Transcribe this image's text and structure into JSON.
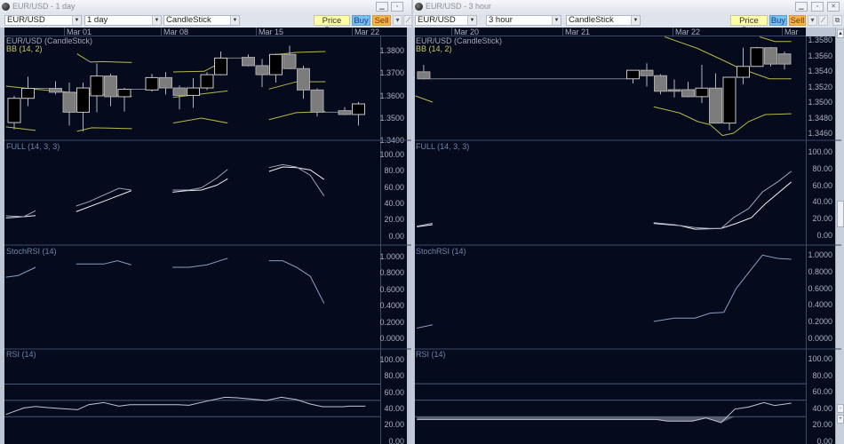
{
  "windows": [
    {
      "title": "EUR/USD - 1 day",
      "symbol": "EUR/USD",
      "interval": "1 day",
      "chart_type": "CandleStick",
      "buttons": {
        "price_box": "Price Box",
        "buy": "Buy",
        "sell": "Sell"
      },
      "time_labels": [
        "Mar 01",
        "Mar 08",
        "Mar 15",
        "Mar 22"
      ],
      "price_label": "EUR/USD (CandleStick)",
      "bb_label": "BB (14, 2)",
      "full_label": "FULL (14, 3, 3)",
      "stoch_label": "StochRSI (14)",
      "rsi_label": "RSI (14)",
      "price_ticks": [
        "1.3800",
        "1.3700",
        "1.3600",
        "1.3500",
        "1.3400"
      ],
      "full_ticks": [
        "100.00",
        "80.00",
        "60.00",
        "40.00",
        "20.00",
        "0.00"
      ],
      "stoch_ticks": [
        "1.0000",
        "0.8000",
        "0.6000",
        "0.4000",
        "0.2000",
        "0.0000"
      ],
      "rsi_ticks": [
        "100.00",
        "80.00",
        "60.00",
        "40.00",
        "20.00",
        "0.00"
      ],
      "rsi_levels": [
        70,
        50,
        30
      ],
      "candles": [
        [
          0,
          1.348,
          1.3599,
          1.345,
          1.3588
        ],
        [
          1,
          1.3588,
          1.3684,
          1.3553,
          1.3632
        ],
        [
          3,
          1.3632,
          1.3664,
          1.3605,
          1.3615
        ],
        [
          4,
          1.3615,
          1.3658,
          1.3467,
          1.3526
        ],
        [
          5,
          1.3526,
          1.3658,
          1.3441,
          1.3634
        ],
        [
          6,
          1.3599,
          1.3743,
          1.3526,
          1.3687
        ],
        [
          7,
          1.3687,
          1.3697,
          1.3553,
          1.3595
        ],
        [
          8,
          1.3595,
          1.3634,
          1.3529,
          1.3628
        ],
        [
          10,
          1.3625,
          1.3697,
          1.3618,
          1.368
        ],
        [
          11,
          1.368,
          1.3704,
          1.3605,
          1.3634
        ],
        [
          12,
          1.3634,
          1.3645,
          1.3539,
          1.3601
        ],
        [
          13,
          1.3601,
          1.3678,
          1.3546,
          1.3634
        ],
        [
          14,
          1.3634,
          1.3704,
          1.3625,
          1.3693
        ],
        [
          15,
          1.3693,
          1.3796,
          1.3691,
          1.3767
        ],
        [
          17,
          1.377,
          1.3783,
          1.373,
          1.3733
        ],
        [
          18,
          1.3733,
          1.3763,
          1.3638,
          1.3693
        ],
        [
          19,
          1.3693,
          1.3787,
          1.3658,
          1.3783
        ],
        [
          20,
          1.3783,
          1.3822,
          1.3717,
          1.372
        ],
        [
          21,
          1.372,
          1.3733,
          1.3586,
          1.3625
        ],
        [
          22,
          1.3625,
          1.3632,
          1.3507,
          1.3526
        ],
        [
          24,
          1.3533,
          1.3549,
          1.3513,
          1.3516
        ],
        [
          25,
          1.3516,
          1.3572,
          1.3467,
          1.3563
        ]
      ],
      "bb": {
        "upper": [
          [
            [
              4.56,
              1.3786
            ],
            [
              5.53,
              1.3749
            ],
            [
              6.39,
              1.3751
            ],
            [
              8.54,
              1.3747
            ]
          ],
          [
            [
              11.55,
              1.3705
            ],
            [
              13.8,
              1.3708
            ],
            [
              15.5,
              1.3763
            ]
          ],
          [
            [
              18.5,
              1.3779
            ],
            [
              20.47,
              1.3792
            ],
            [
              22.6,
              1.3796
            ]
          ]
        ],
        "mid": [
          [
            [
              -0.6,
              1.3642
            ],
            [
              1.55,
              1.3628
            ],
            [
              4.56,
              1.3612
            ],
            [
              8.54,
              1.3597
            ]
          ],
          [
            [
              11.55,
              1.3592
            ],
            [
              15.5,
              1.3621
            ]
          ],
          [
            [
              18.5,
              1.3629
            ],
            [
              20.47,
              1.3661
            ],
            [
              22.6,
              1.3662
            ]
          ]
        ],
        "lower": [
          [
            [
              -0.6,
              1.3461
            ],
            [
              1.55,
              1.3445
            ]
          ],
          [
            [
              4.56,
              1.3441
            ],
            [
              5.63,
              1.3457
            ],
            [
              8.54,
              1.3453
            ]
          ],
          [
            [
              11.55,
              1.3478
            ],
            [
              13.6,
              1.35
            ],
            [
              15.5,
              1.3478
            ]
          ],
          [
            [
              18.5,
              1.3493
            ],
            [
              20.47,
              1.3524
            ],
            [
              22.6,
              1.3529
            ]
          ]
        ]
      },
      "full": {
        "k": [
          [
            [
              -0.6,
              24.6
            ],
            [
              0.7,
              23.6
            ],
            [
              1.55,
              30.8
            ]
          ],
          [
            [
              4.5,
              36.6
            ],
            [
              5.4,
              41.7
            ],
            [
              7.6,
              58.3
            ],
            [
              8.5,
              56.2
            ]
          ],
          [
            [
              11.5,
              56.2
            ],
            [
              12.7,
              56.2
            ],
            [
              13.6,
              59
            ],
            [
              14.7,
              70.6
            ],
            [
              15.5,
              81.5
            ]
          ],
          [
            [
              18.5,
              83.7
            ],
            [
              19.5,
              87.3
            ],
            [
              20.5,
              84.4
            ],
            [
              21.5,
              74.3
            ],
            [
              22.5,
              48.9
            ]
          ]
        ],
        "d": [
          [
            [
              -0.6,
              22
            ],
            [
              0.7,
              23.6
            ],
            [
              1.55,
              25
            ]
          ],
          [
            [
              4.5,
              29.7
            ],
            [
              6.5,
              42.4
            ],
            [
              8.5,
              55.4
            ]
          ],
          [
            [
              11.5,
              53.6
            ],
            [
              12.5,
              55.4
            ],
            [
              13.6,
              56.2
            ],
            [
              14.7,
              62
            ],
            [
              15.5,
              70
            ]
          ],
          [
            [
              18.5,
              78.9
            ],
            [
              19.5,
              84.4
            ],
            [
              20.5,
              83.7
            ],
            [
              21.5,
              80.8
            ],
            [
              22.5,
              69.2
            ]
          ]
        ]
      },
      "stoch": [
        [
          [
            -0.6,
            0.75
          ],
          [
            0.3,
            0.77
          ],
          [
            1.55,
            0.87
          ]
        ],
        [
          [
            4.5,
            0.91
          ],
          [
            6.5,
            0.91
          ],
          [
            7.5,
            0.95
          ],
          [
            8.5,
            0.9
          ]
        ],
        [
          [
            11.5,
            0.87
          ],
          [
            12.7,
            0.87
          ],
          [
            14,
            0.9
          ],
          [
            15.5,
            0.98
          ]
        ],
        [
          [
            18.5,
            0.95
          ],
          [
            19.5,
            0.95
          ],
          [
            20.5,
            0.87
          ],
          [
            21.5,
            0.76
          ],
          [
            22.5,
            0.43
          ]
        ]
      ],
      "rsi": [
        [
          -0.6,
          32.7
        ],
        [
          0.7,
          40.7
        ],
        [
          1.55,
          42.5
        ],
        [
          2.4,
          41.1
        ],
        [
          3.3,
          40
        ],
        [
          4.6,
          38.5
        ],
        [
          5.4,
          44.7
        ],
        [
          6.5,
          47.3
        ],
        [
          7.6,
          42.9
        ],
        [
          8.4,
          44.7
        ],
        [
          11.9,
          44.7
        ],
        [
          12.7,
          44
        ],
        [
          14,
          49.1
        ],
        [
          15.3,
          53.8
        ],
        [
          16.2,
          53.1
        ],
        [
          17.2,
          51.6
        ],
        [
          18.3,
          49.8
        ],
        [
          19.4,
          53.8
        ],
        [
          20.5,
          50.9
        ],
        [
          21.5,
          45.5
        ],
        [
          22.4,
          42.2
        ],
        [
          23.9,
          42.2
        ],
        [
          24.3,
          42.9
        ],
        [
          25.5,
          42.9
        ]
      ]
    },
    {
      "title": "EUR/USD - 3 hour",
      "symbol": "EUR/USD",
      "interval": "3 hour",
      "chart_type": "CandleStick",
      "buttons": {
        "price_box": "Price Box",
        "buy": "Buy",
        "sell": "Sell"
      },
      "time_labels": [
        "Mar 20",
        "Mar 21",
        "Mar 22",
        "Mar"
      ],
      "price_label": "EUR/USD (CandleStick)",
      "bb_label": "BB (14, 2)",
      "full_label": "FULL (14, 3, 3)",
      "stoch_label": "StochRSI (14)",
      "rsi_label": "RSI (14)",
      "price_ticks": [
        "1.3580",
        "1.3560",
        "1.3540",
        "1.3520",
        "1.3500",
        "1.3480",
        "1.3460"
      ],
      "full_ticks": [
        "100.00",
        "80.00",
        "60.00",
        "40.00",
        "20.00",
        "0.00"
      ],
      "stoch_ticks": [
        "1.0000",
        "0.8000",
        "0.6000",
        "0.4000",
        "0.2000",
        "0.0000"
      ],
      "rsi_ticks": [
        "100.00",
        "80.00",
        "60.00",
        "40.00",
        "20.00",
        "0.00"
      ],
      "rsi_levels": [
        70,
        50,
        30
      ],
      "candles": [
        [
          -0.2,
          1.3539,
          1.3548,
          1.3529,
          1.353
        ],
        [
          15,
          1.353,
          1.3541,
          1.3524,
          1.3541
        ],
        [
          16,
          1.3541,
          1.355,
          1.352,
          1.3534
        ],
        [
          17,
          1.3534,
          1.3536,
          1.351,
          1.3514
        ],
        [
          18,
          1.3516,
          1.3529,
          1.3506,
          1.3514
        ],
        [
          19,
          1.3516,
          1.3526,
          1.3506,
          1.3507
        ],
        [
          20,
          1.3507,
          1.3548,
          1.3499,
          1.3518
        ],
        [
          21,
          1.3518,
          1.3537,
          1.3473,
          1.3473
        ],
        [
          22,
          1.3473,
          1.3532,
          1.3464,
          1.3532
        ],
        [
          23,
          1.3532,
          1.357,
          1.3523,
          1.3546
        ],
        [
          24,
          1.3546,
          1.3571,
          1.3546,
          1.357
        ],
        [
          25,
          1.357,
          1.3571,
          1.3546,
          1.3549
        ],
        [
          26,
          1.3562,
          1.3565,
          1.3542,
          1.3549
        ]
      ],
      "bb": {
        "upper": [
          [
            [
              24.2,
              1.3584
            ],
            [
              25.3,
              1.3578
            ],
            [
              26.5,
              1.3578
            ]
          ]
        ],
        "mid": [
          [
            [
              17.3,
              1.3584
            ],
            [
              19.7,
              1.3569
            ],
            [
              21.4,
              1.3555
            ],
            [
              22.7,
              1.3544
            ],
            [
              24.9,
              1.353
            ],
            [
              26.5,
              1.353
            ]
          ]
        ],
        "lower": [
          [
            [
              -0.8,
              1.3508
            ],
            [
              0.45,
              1.35
            ]
          ],
          [
            [
              16.5,
              1.3494
            ],
            [
              18.4,
              1.3486
            ],
            [
              19.7,
              1.3475
            ],
            [
              20.6,
              1.3471
            ],
            [
              21.5,
              1.3457
            ],
            [
              22.3,
              1.346
            ],
            [
              23.4,
              1.3475
            ],
            [
              24.6,
              1.3484
            ],
            [
              26.5,
              1.3485
            ]
          ]
        ]
      },
      "full": {
        "k": [
          [
            [
              -0.7,
              10.7
            ],
            [
              0.45,
              14.3
            ]
          ],
          [
            [
              16.5,
              15
            ],
            [
              18,
              12.5
            ],
            [
              19.5,
              9
            ],
            [
              20.6,
              8
            ],
            [
              21.4,
              8
            ],
            [
              22.3,
              21
            ],
            [
              23.4,
              32
            ],
            [
              24.4,
              52
            ],
            [
              25.5,
              64
            ],
            [
              26.5,
              77
            ]
          ]
        ],
        "d": [
          [
            [
              -0.7,
              10
            ],
            [
              0.45,
              12.5
            ]
          ],
          [
            [
              16.5,
              14
            ],
            [
              18.4,
              11.4
            ],
            [
              19.5,
              7
            ],
            [
              21.4,
              8
            ],
            [
              22.5,
              14
            ],
            [
              23.6,
              21
            ],
            [
              24.6,
              37.5
            ],
            [
              26.5,
              64
            ]
          ]
        ]
      },
      "stoch": [
        [
          [
            -0.7,
            0.12
          ],
          [
            0.45,
            0.16
          ]
        ],
        [
          [
            16.5,
            0.2
          ],
          [
            18,
            0.24
          ],
          [
            19.5,
            0.24
          ],
          [
            20.6,
            0.3
          ],
          [
            21.6,
            0.31
          ],
          [
            22.5,
            0.6
          ],
          [
            24.4,
            1.0
          ],
          [
            25.5,
            0.96
          ],
          [
            26.5,
            0.95
          ]
        ]
      ],
      "rsi": [
        [
          -0.7,
          26.6
        ],
        [
          16.7,
          26.6
        ],
        [
          17.5,
          24.5
        ],
        [
          19.3,
          24.5
        ],
        [
          20.3,
          28.4
        ],
        [
          21.4,
          22.7
        ],
        [
          22.4,
          39.2
        ],
        [
          23.4,
          41.7
        ],
        [
          24.5,
          47
        ],
        [
          25.3,
          43.5
        ],
        [
          26.5,
          46.4
        ]
      ]
    }
  ]
}
